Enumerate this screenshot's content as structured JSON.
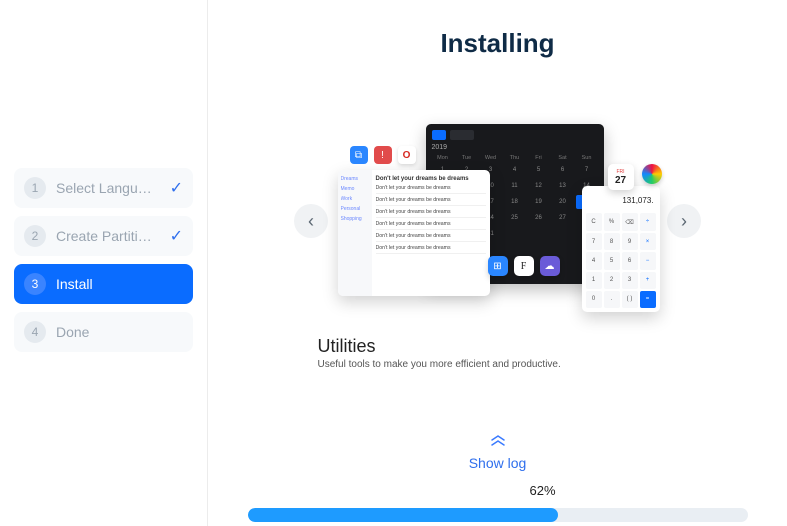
{
  "sidebar": {
    "steps": [
      {
        "num": "1",
        "label": "Select Langu…",
        "done": true,
        "active": false
      },
      {
        "num": "2",
        "label": "Create Partiti…",
        "done": true,
        "active": false
      },
      {
        "num": "3",
        "label": "Install",
        "done": false,
        "active": true
      },
      {
        "num": "4",
        "label": "Done",
        "done": false,
        "active": false
      }
    ]
  },
  "main": {
    "title": "Installing",
    "slide": {
      "title": "Utilities",
      "subtitle": "Useful tools to make you more efficient and productive.",
      "calendar": {
        "year": "2019",
        "days": [
          "Mon",
          "Tue",
          "Wed",
          "Thu",
          "Fri",
          "Sat",
          "Sun"
        ]
      },
      "notes_line": "Don't let your dreams be dreams",
      "calc_display": "131,073.",
      "date_badge": {
        "dow": "FRI",
        "num": "27"
      }
    },
    "showlog": "Show log",
    "progress": {
      "percent_label": "62%",
      "percent_value": 62
    }
  }
}
